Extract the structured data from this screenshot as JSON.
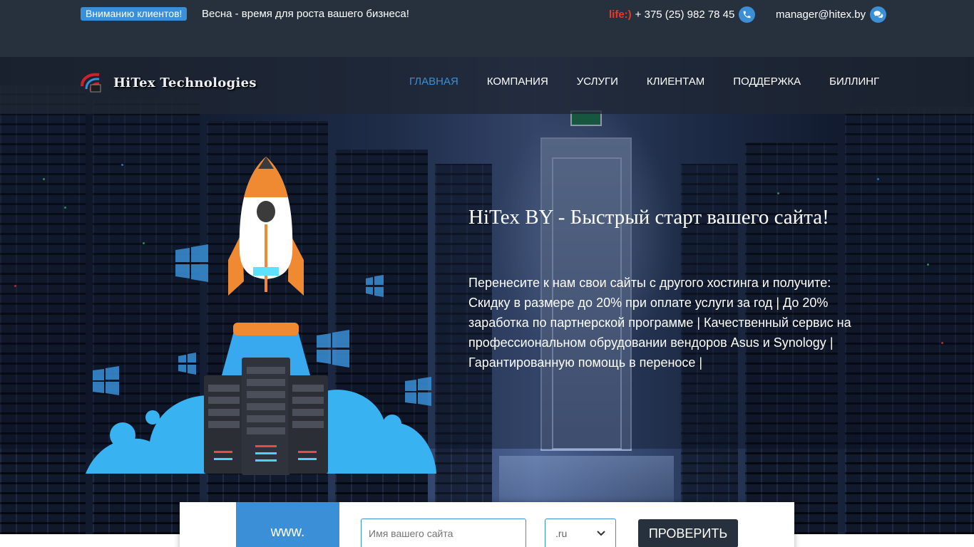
{
  "topbar": {
    "notice_badge": "Вниманию клиентов!",
    "notice_text": "Весна - время для роста вашего бизнеса!",
    "phone_operator": "life:)",
    "phone": "+ 375 (25) 982 78 45",
    "phone_icon": "phone-icon",
    "email": "manager@hitex.by",
    "chat_icon": "chat-bubbles-icon"
  },
  "brand": {
    "logo_text": "HiTex Technologies"
  },
  "nav": {
    "items": [
      {
        "label": "ГЛАВНАЯ",
        "active": true
      },
      {
        "label": "КОМПАНИЯ",
        "active": false
      },
      {
        "label": "УСЛУГИ",
        "active": false
      },
      {
        "label": "КЛИЕНТАМ",
        "active": false
      },
      {
        "label": "ПОДДЕРЖКА",
        "active": false
      },
      {
        "label": "БИЛЛИНГ",
        "active": false
      }
    ]
  },
  "hero": {
    "title": "HiTex BY - Быстрый старт вашего сайта!",
    "description": "Перенесите к нам свои сайты с другого хостинга и получите: Скидку в размере до 20% при оплате услуги за год | До 20% заработка по партнерской программе | Качественный сервис на профессиональном обрудовании вендоров Asus и Synology | Гарантированную помощь в переносе |",
    "illustration": "rocket-launch-with-servers-illustration"
  },
  "domain_check": {
    "prefix": "www.",
    "input_placeholder": "Имя вашего сайта",
    "input_value": "",
    "zone_selected": ".ru",
    "button_label": "ПРОВЕРИТЬ"
  },
  "colors": {
    "accent": "#3a8fd6",
    "topbar_bg": "#27313d",
    "operator_red": "#e8392b",
    "button_dark": "#27313d"
  }
}
